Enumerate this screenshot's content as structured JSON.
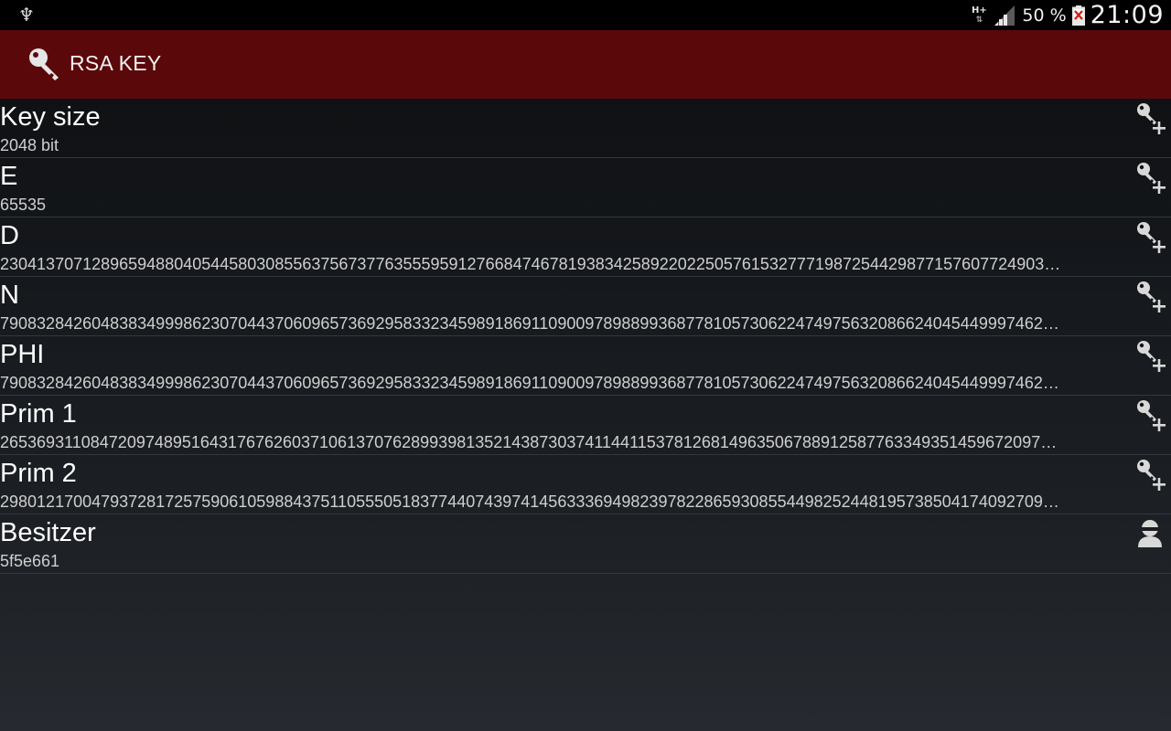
{
  "statusbar": {
    "usb_symbol": "♆",
    "network_type": "H+",
    "network_arrows": "⇅",
    "battery_percent": "50 %",
    "time": "21:09"
  },
  "actionbar": {
    "title": "RSA KEY",
    "icon": "key-icon"
  },
  "rows": [
    {
      "title": "Key size",
      "value": "2048 bit",
      "icon": "add-key-icon"
    },
    {
      "title": "E",
      "value": "65535",
      "icon": "add-key-icon"
    },
    {
      "title": "D",
      "value": "230413707128965948804054458030855637567377635559591276684746781938342589220225057615327771987254429877157607724903…",
      "icon": "add-key-icon"
    },
    {
      "title": "N",
      "value": "790832842604838349998623070443706096573692958332345989186911090097898899368778105730622474975632086624045449997462…",
      "icon": "add-key-icon"
    },
    {
      "title": "PHI",
      "value": "790832842604838349998623070443706096573692958332345989186911090097898899368778105730622474975632086624045449997462…",
      "icon": "add-key-icon"
    },
    {
      "title": "Prim 1",
      "value": "265369311084720974895164317676260371061370762899398135214387303741144115378126814963506788912587763349351459672097…",
      "icon": "add-key-icon"
    },
    {
      "title": "Prim 2",
      "value": "298012170047937281725759061059884375110555051837744074397414563336949823978228659308554498252448195738504174092709…",
      "icon": "add-key-icon"
    },
    {
      "title": "Besitzer",
      "value": "5f5e661",
      "icon": "person-icon"
    }
  ]
}
